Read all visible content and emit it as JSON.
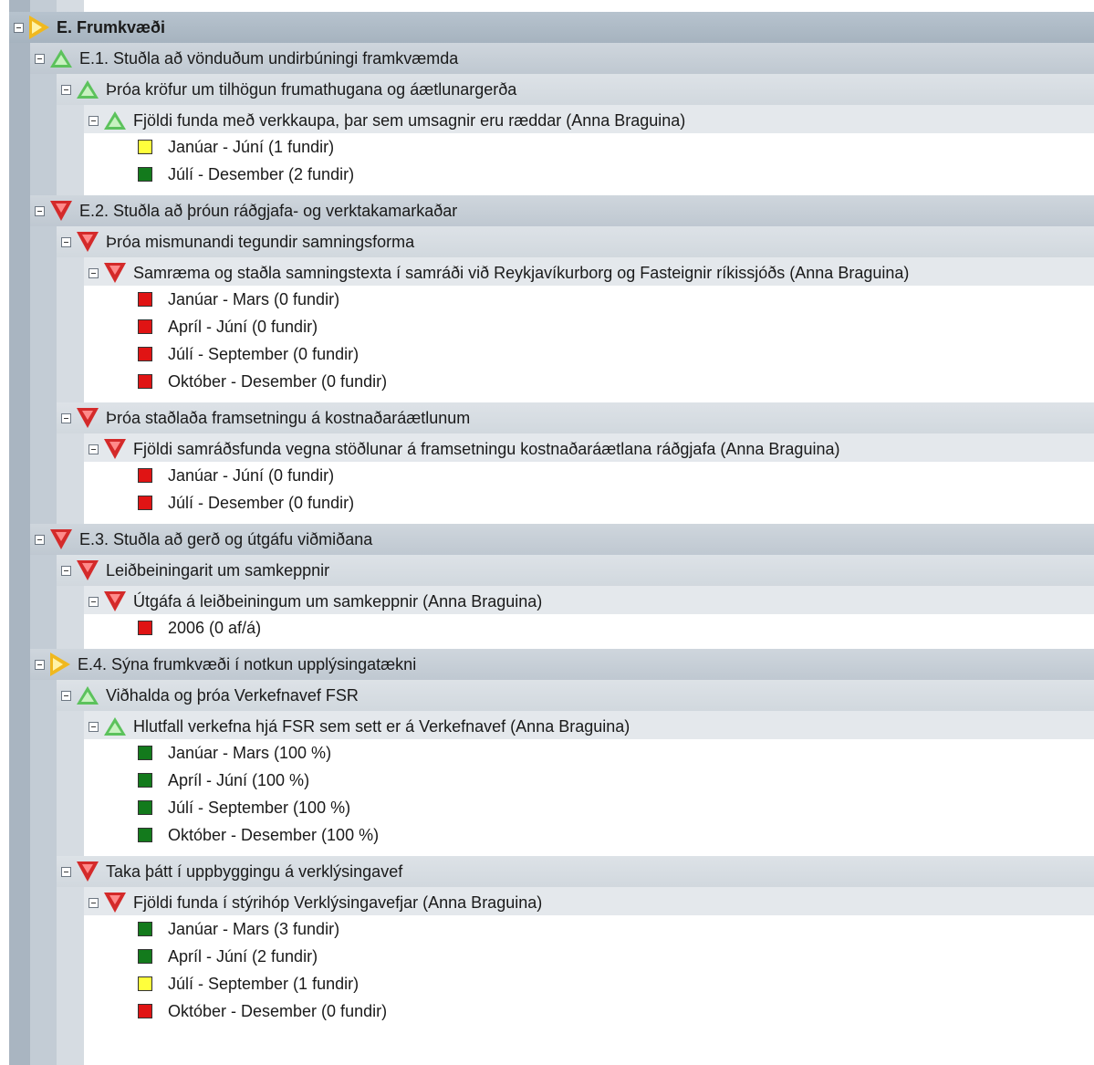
{
  "root": {
    "label": "E. Frumkvæði",
    "status": "warning-icon"
  },
  "colors": {
    "green": "#137a1c",
    "red": "#e01414",
    "yellow": "#ffff3c"
  },
  "sections": [
    {
      "label": "E.1. Stuðla að vönduðum undirbúningi framkvæmda",
      "status": "up-icon",
      "groups": [
        {
          "label": "Þróa kröfur um tilhögun frumathugana og áætlunargerða",
          "status": "up-icon",
          "measures": [
            {
              "label": "Fjöldi funda með verkkaupa, þar sem umsagnir eru ræddar (Anna Braguina)",
              "status": "up-icon",
              "periods": [
                {
                  "label": "Janúar - Júní (1 fundir)",
                  "color": "yellow"
                },
                {
                  "label": "Júlí - Desember (2 fundir)",
                  "color": "green"
                }
              ]
            }
          ]
        }
      ]
    },
    {
      "label": "E.2. Stuðla að þróun ráðgjafa- og verktakamarkaðar",
      "status": "down-icon",
      "groups": [
        {
          "label": "Þróa mismunandi tegundir samningsforma",
          "status": "down-icon",
          "measures": [
            {
              "label": "Samræma og staðla samningstexta í samráði við Reykjavíkurborg og Fasteignir ríkissjóðs (Anna Braguina)",
              "status": "down-icon",
              "periods": [
                {
                  "label": "Janúar - Mars (0 fundir)",
                  "color": "red"
                },
                {
                  "label": "Apríl - Júní (0 fundir)",
                  "color": "red"
                },
                {
                  "label": "Júlí - September (0 fundir)",
                  "color": "red"
                },
                {
                  "label": "Október - Desember (0 fundir)",
                  "color": "red"
                }
              ]
            }
          ]
        },
        {
          "label": "Þróa staðlaða framsetningu á kostnaðaráætlunum",
          "status": "down-icon",
          "measures": [
            {
              "label": "Fjöldi samráðsfunda vegna stöðlunar á framsetningu kostnaðaráætlana ráðgjafa (Anna Braguina)",
              "status": "down-icon",
              "periods": [
                {
                  "label": "Janúar - Júní (0 fundir)",
                  "color": "red"
                },
                {
                  "label": "Júlí - Desember (0 fundir)",
                  "color": "red"
                }
              ]
            }
          ]
        }
      ]
    },
    {
      "label": "E.3. Stuðla að gerð og útgáfu viðmiðana",
      "status": "down-icon",
      "groups": [
        {
          "label": "Leiðbeiningarit um samkeppnir",
          "status": "down-icon",
          "measures": [
            {
              "label": "Útgáfa á leiðbeiningum um samkeppnir (Anna Braguina)",
              "status": "down-icon",
              "periods": [
                {
                  "label": "2006 (0 af/á)",
                  "color": "red"
                }
              ]
            }
          ]
        }
      ]
    },
    {
      "label": "E.4. Sýna frumkvæði í notkun upplýsingatækni",
      "status": "warning-icon",
      "groups": [
        {
          "label": "Viðhalda og þróa Verkefnavef FSR",
          "status": "up-icon",
          "measures": [
            {
              "label": "Hlutfall verkefna hjá FSR sem sett er á Verkefnavef (Anna Braguina)",
              "status": "up-icon",
              "periods": [
                {
                  "label": "Janúar - Mars (100 %)",
                  "color": "green"
                },
                {
                  "label": "Apríl - Júní (100 %)",
                  "color": "green"
                },
                {
                  "label": "Júlí - September (100 %)",
                  "color": "green"
                },
                {
                  "label": "Október - Desember (100 %)",
                  "color": "green"
                }
              ]
            }
          ]
        },
        {
          "label": "Taka þátt í uppbyggingu á verklýsingavef",
          "status": "down-icon",
          "measures": [
            {
              "label": "Fjöldi funda í stýrihóp Verklýsingavefjar (Anna Braguina)",
              "status": "down-icon",
              "periods": [
                {
                  "label": "Janúar - Mars (3 fundir)",
                  "color": "green"
                },
                {
                  "label": "Apríl - Júní (2 fundir)",
                  "color": "green"
                },
                {
                  "label": "Júlí - September (1 fundir)",
                  "color": "yellow"
                },
                {
                  "label": "Október - Desember (0 fundir)",
                  "color": "red"
                }
              ]
            }
          ]
        }
      ]
    }
  ]
}
